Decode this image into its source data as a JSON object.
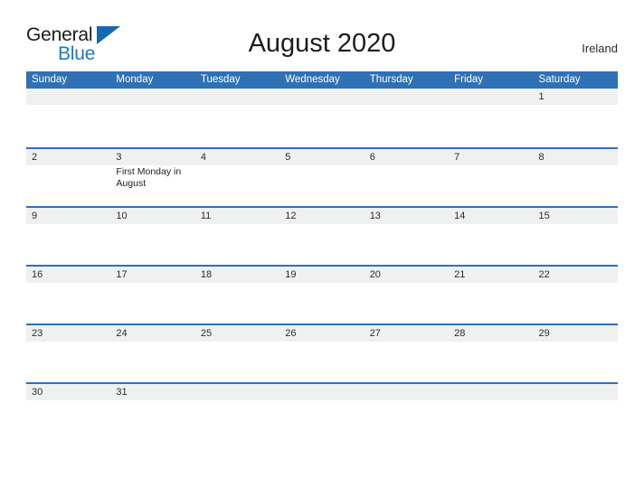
{
  "brand": {
    "word_one": "General",
    "word_two": "Blue",
    "triangle_color": "#1469b0",
    "blue_text_color": "#1a7ac4"
  },
  "header": {
    "title": "August 2020",
    "country": "Ireland"
  },
  "theme": {
    "header_blue": "#2e71b5",
    "row_rule_blue": "#2e71b5",
    "date_strip_gray": "#eff0f0",
    "page_background": "#ffffff",
    "text_color": "#2b2b2b"
  },
  "calendar": {
    "month": "August",
    "year": "2020",
    "weekday_headers": [
      "Sunday",
      "Monday",
      "Tuesday",
      "Wednesday",
      "Thursday",
      "Friday",
      "Saturday"
    ],
    "weeks": [
      {
        "days": [
          {
            "num": "",
            "event": ""
          },
          {
            "num": "",
            "event": ""
          },
          {
            "num": "",
            "event": ""
          },
          {
            "num": "",
            "event": ""
          },
          {
            "num": "",
            "event": ""
          },
          {
            "num": "",
            "event": ""
          },
          {
            "num": "1",
            "event": ""
          }
        ]
      },
      {
        "days": [
          {
            "num": "2",
            "event": ""
          },
          {
            "num": "3",
            "event": "First Monday in August"
          },
          {
            "num": "4",
            "event": ""
          },
          {
            "num": "5",
            "event": ""
          },
          {
            "num": "6",
            "event": ""
          },
          {
            "num": "7",
            "event": ""
          },
          {
            "num": "8",
            "event": ""
          }
        ]
      },
      {
        "days": [
          {
            "num": "9",
            "event": ""
          },
          {
            "num": "10",
            "event": ""
          },
          {
            "num": "11",
            "event": ""
          },
          {
            "num": "12",
            "event": ""
          },
          {
            "num": "13",
            "event": ""
          },
          {
            "num": "14",
            "event": ""
          },
          {
            "num": "15",
            "event": ""
          }
        ]
      },
      {
        "days": [
          {
            "num": "16",
            "event": ""
          },
          {
            "num": "17",
            "event": ""
          },
          {
            "num": "18",
            "event": ""
          },
          {
            "num": "19",
            "event": ""
          },
          {
            "num": "20",
            "event": ""
          },
          {
            "num": "21",
            "event": ""
          },
          {
            "num": "22",
            "event": ""
          }
        ]
      },
      {
        "days": [
          {
            "num": "23",
            "event": ""
          },
          {
            "num": "24",
            "event": ""
          },
          {
            "num": "25",
            "event": ""
          },
          {
            "num": "26",
            "event": ""
          },
          {
            "num": "27",
            "event": ""
          },
          {
            "num": "28",
            "event": ""
          },
          {
            "num": "29",
            "event": ""
          }
        ]
      },
      {
        "days": [
          {
            "num": "30",
            "event": ""
          },
          {
            "num": "31",
            "event": ""
          },
          {
            "num": "",
            "event": ""
          },
          {
            "num": "",
            "event": ""
          },
          {
            "num": "",
            "event": ""
          },
          {
            "num": "",
            "event": ""
          },
          {
            "num": "",
            "event": ""
          }
        ]
      }
    ]
  }
}
